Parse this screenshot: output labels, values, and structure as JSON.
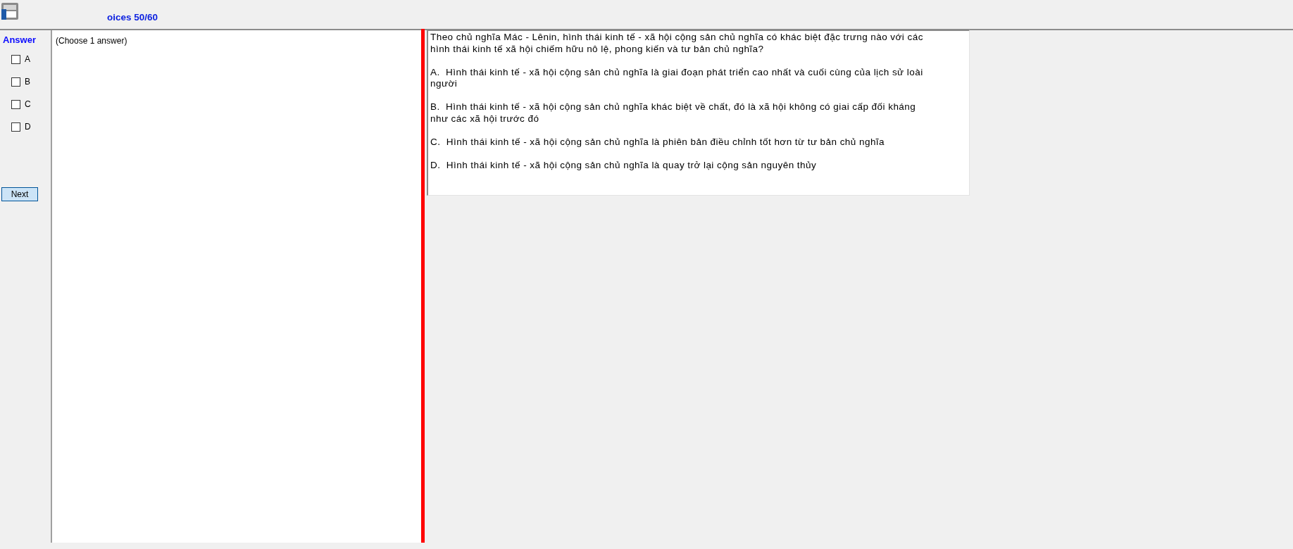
{
  "header": {
    "title": "oices 50/60"
  },
  "answer_panel": {
    "heading": "Answer",
    "options": [
      {
        "label": "A",
        "checked": false
      },
      {
        "label": "B",
        "checked": false
      },
      {
        "label": "C",
        "checked": false
      },
      {
        "label": "D",
        "checked": false
      }
    ],
    "next_button": "Next"
  },
  "instruction": "(Choose 1 answer)",
  "question": {
    "text": "Theo chủ nghĩa Mác - Lênin, hình thái kinh tế - xã hội cộng sản chủ nghĩa có khác biệt đặc trưng nào với các hình thái kinh tế xã hội chiếm hữu nô lệ, phong kiến và tư bản chủ nghĩa?",
    "options": [
      "A.  Hình thái kinh tế - xã hội cộng sản chủ nghĩa là giai đoạn phát triển cao nhất và cuối cùng của lịch sử loài người",
      "B.  Hình thái kinh tế - xã hội cộng sản chủ nghĩa khác biệt về chất, đó là xã hội không có giai cấp đối kháng như các xã hội trước đó",
      "C.  Hình thái kinh tế - xã hội cộng sản chủ nghĩa là phiên bản điều chỉnh tốt hơn từ tư bản chủ nghĩa",
      "D.  Hình thái kinh tế - xã hội cộng sản chủ nghĩa là quay trở lại cộng sản nguyên thủy"
    ]
  }
}
